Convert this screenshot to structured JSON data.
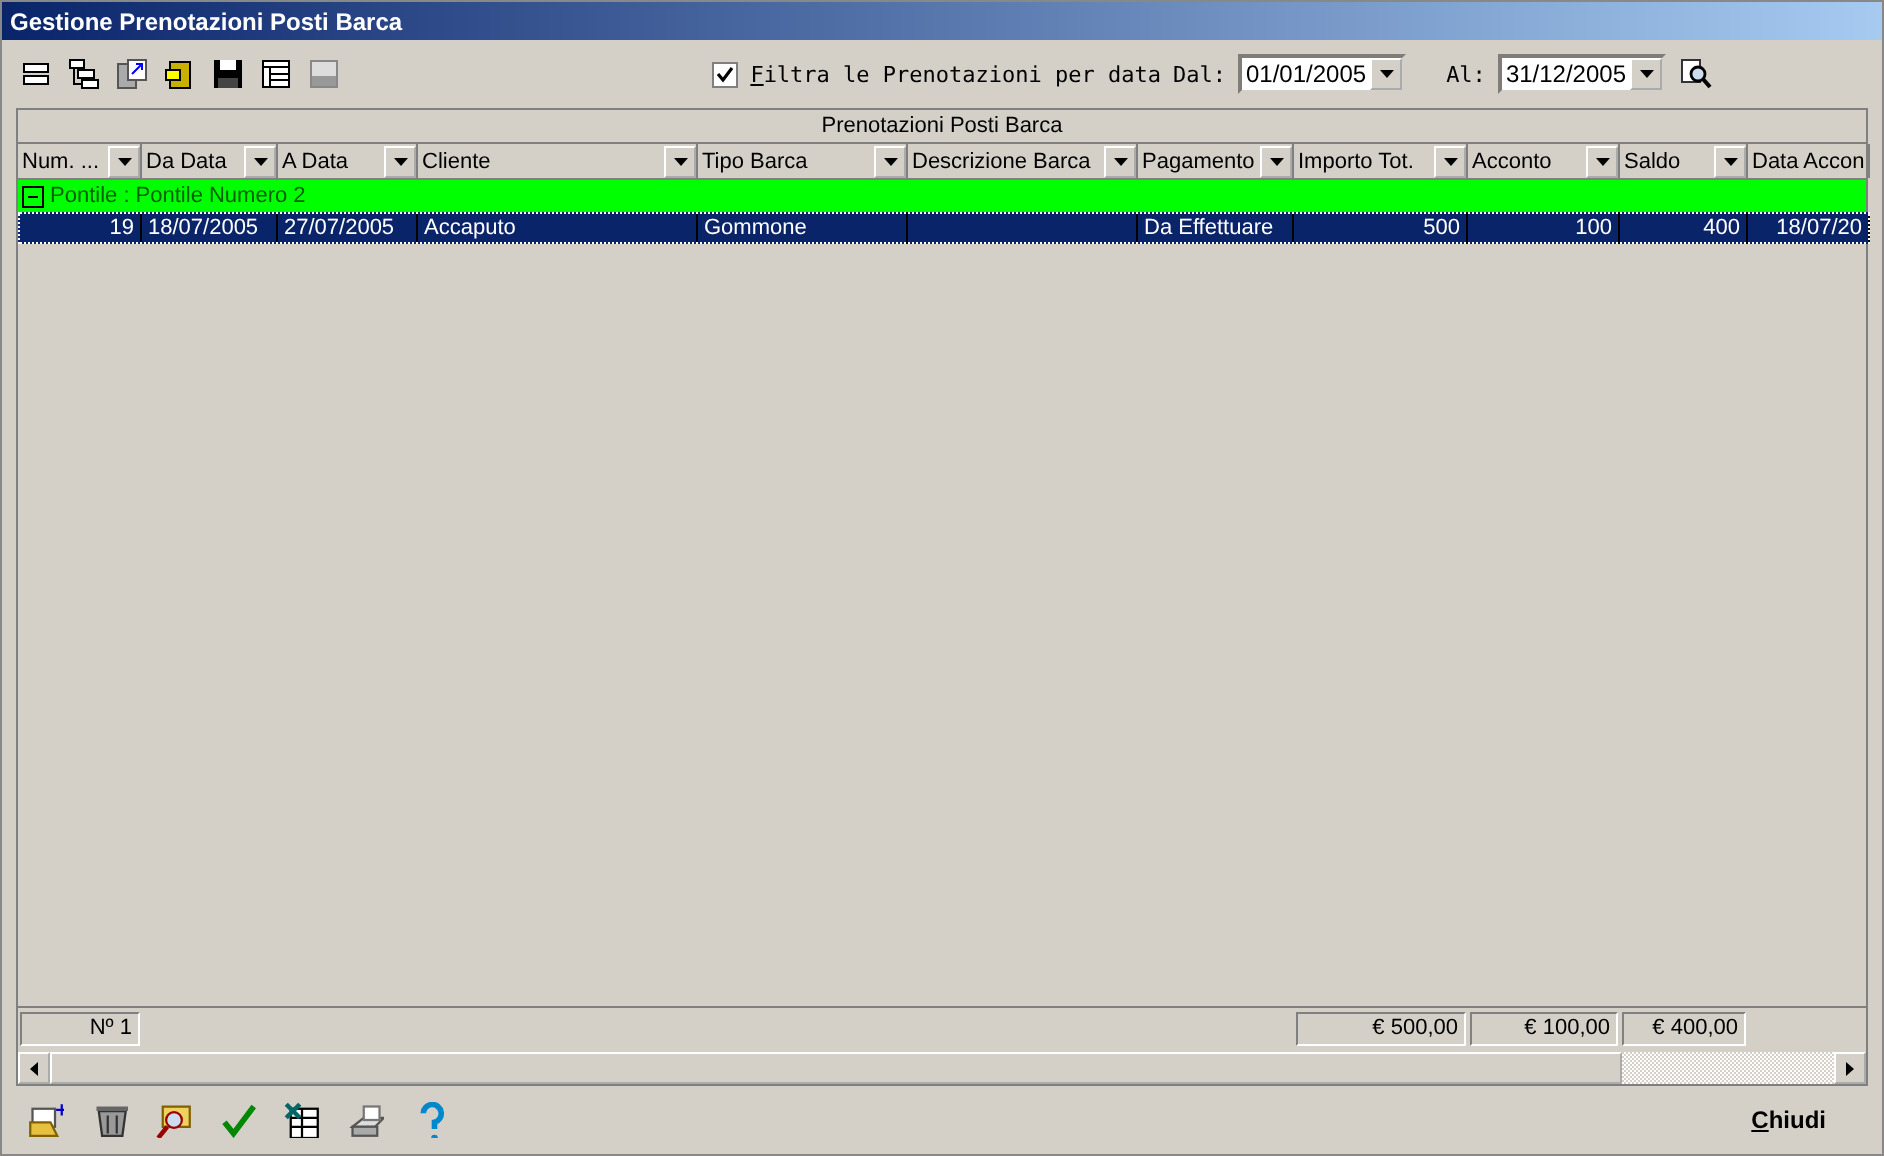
{
  "window": {
    "title": "Gestione Prenotazioni Posti Barca"
  },
  "filter": {
    "label": "Filtra le Prenotazioni per data",
    "checked": true,
    "from_label": "Dal:",
    "from": "01/01/2005",
    "to_label": "Al:",
    "to": "31/12/2005"
  },
  "table": {
    "title": "Prenotazioni Posti Barca",
    "columns": [
      "Num. ...",
      "Da Data",
      "A Data",
      "Cliente",
      "Tipo Barca",
      "Descrizione Barca",
      "Pagamento",
      "Importo Tot.",
      "Acconto",
      "Saldo",
      "Data Accon"
    ],
    "groups": [
      {
        "label": "Pontile : Pontile Numero 2",
        "expanded": true,
        "rows": [
          {
            "cells": [
              "19",
              "18/07/2005",
              "27/07/2005",
              "Accaputo",
              "Gommone",
              "",
              "Da Effettuare",
              "500",
              "100",
              "400",
              "18/07/20"
            ],
            "selected": true
          }
        ]
      }
    ]
  },
  "summary": {
    "count": "Nº 1",
    "totals": [
      "€ 500,00",
      "€ 100,00",
      "€ 400,00"
    ]
  },
  "close_button": "Chiudi"
}
